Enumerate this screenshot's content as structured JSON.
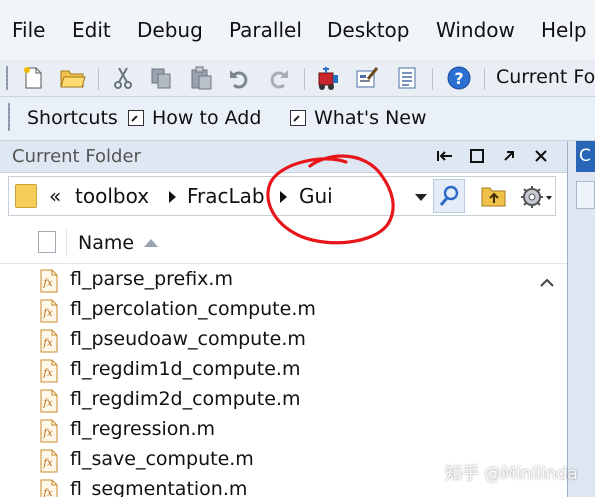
{
  "menubar": {
    "items": [
      "File",
      "Edit",
      "Debug",
      "Parallel",
      "Desktop",
      "Window",
      "Help"
    ]
  },
  "toolbar": {
    "icons": [
      "new-file-icon",
      "open-folder-icon",
      "cut-icon",
      "copy-icon",
      "paste-icon",
      "undo-icon",
      "redo-icon",
      "simulink-icon",
      "guide-icon",
      "profiler-icon",
      "help-icon"
    ],
    "current_folder_label": "Current Fo"
  },
  "shortcuts": {
    "label": "Shortcuts",
    "items": [
      "How to Add",
      "What's New"
    ]
  },
  "panel": {
    "title": "Current Folder",
    "breadcrumb": {
      "prefix": "«",
      "parts": [
        "toolbox",
        "FracLab",
        "Gui"
      ]
    },
    "column_header": "Name",
    "files": [
      "fl_parse_prefix.m",
      "fl_percolation_compute.m",
      "fl_pseudoaw_compute.m",
      "fl_regdim1d_compute.m",
      "fl_regdim2d_compute.m",
      "fl_regression.m",
      "fl_save_compute.m",
      "fl_segmentation.m"
    ]
  },
  "right_panel": {
    "tab_letter": "C"
  },
  "watermark": "知乎 @Minilinda",
  "colors": {
    "annotation": "#e8161b",
    "right_tab": "#2a66b7"
  }
}
